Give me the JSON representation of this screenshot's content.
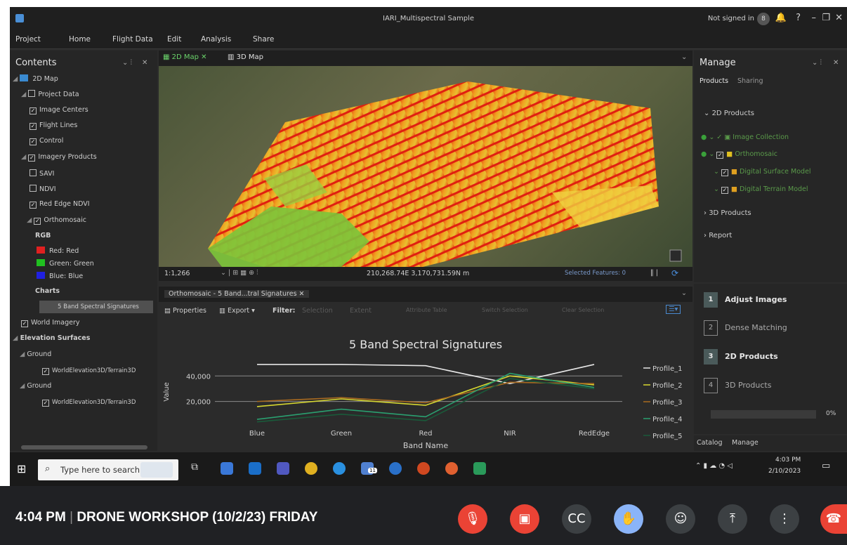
{
  "window": {
    "title": "IARI_Multispectral Sample",
    "signin": "Not signed in",
    "user_initial": "8"
  },
  "ribbon": [
    "Project",
    "Home",
    "Flight Data",
    "Edit",
    "Analysis",
    "Share"
  ],
  "contents": {
    "title": "Contents",
    "rows": [
      "2D Map",
      "Project Data",
      "Image Centers",
      "Flight Lines",
      "Control",
      "Imagery Products",
      "SAVI",
      "NDVI",
      "Red Edge NDVI",
      "Orthomosaic",
      "RGB",
      "Red: Red",
      "Green: Green",
      "Blue: Blue",
      "Charts",
      "5 Band Spectral Signatures",
      "World Imagery",
      "Elevation Surfaces",
      "Ground",
      "WorldElevation3D/Terrain3D",
      "Ground",
      "WorldElevation3D/Terrain3D"
    ]
  },
  "map": {
    "tab_2d": "2D Map",
    "tab_3d": "3D Map",
    "scale": "1:1,266",
    "coords": "210,268.74E 3,170,731.59N m",
    "selected": "Selected Features: 0"
  },
  "chart_pane": {
    "tab": "Orthomosaic - 5 Band...tral Signatures",
    "properties": "Properties",
    "export": "Export",
    "filter": "Filter:",
    "selection": "Selection",
    "extent": "Extent",
    "attribute_table": "Attribute Table",
    "switch_selection": "Switch Selection",
    "clear_selection": "Clear Selection"
  },
  "chart_data": {
    "type": "line",
    "title": "5 Band Spectral Signatures",
    "xlabel": "Band Name",
    "ylabel": "Value",
    "categories": [
      "Blue",
      "Green",
      "Red",
      "NIR",
      "RedEdge"
    ],
    "yticks": [
      "20,000",
      "40,000"
    ],
    "ylim": [
      0,
      55000
    ],
    "grid": true,
    "legend": "right",
    "series": [
      {
        "name": "Profile_1",
        "color": "#e6e6e6",
        "values": [
          49000,
          49000,
          48000,
          34000,
          49000
        ]
      },
      {
        "name": "Profile_2",
        "color": "#d8d830",
        "values": [
          16000,
          22000,
          17000,
          40000,
          33000
        ]
      },
      {
        "name": "Profile_3",
        "color": "#a86a20",
        "values": [
          20000,
          23000,
          19000,
          35000,
          34000
        ]
      },
      {
        "name": "Profile_4",
        "color": "#2aa070",
        "values": [
          6000,
          14000,
          8000,
          42000,
          31000
        ]
      },
      {
        "name": "Profile_5",
        "color": "#1a5a3a",
        "values": [
          4000,
          10000,
          5000,
          38000,
          30000
        ]
      }
    ]
  },
  "manage": {
    "title": "Manage",
    "tab_products": "Products",
    "tab_sharing": "Sharing",
    "d2_products": "2D Products",
    "image_collection": "Image Collection",
    "orthomosaic": "Orthomosaic",
    "dsm": "Digital Surface Model",
    "dtm": "Digital Terrain Model",
    "d3_products": "3D Products",
    "report": "Report"
  },
  "workflow": {
    "steps": [
      {
        "num": "1",
        "label": "Adjust Images"
      },
      {
        "num": "2",
        "label": "Dense Matching"
      },
      {
        "num": "3",
        "label": "2D Products"
      },
      {
        "num": "4",
        "label": "3D Products"
      }
    ],
    "progress": "0%",
    "progress_value": 0
  },
  "bottom_tabs": {
    "catalog": "Catalog",
    "manage": "Manage"
  },
  "taskbar": {
    "search_placeholder": "Type here to search",
    "time": "4:03 PM",
    "date": "2/10/2023",
    "teams_badge": "11"
  },
  "meeting": {
    "label_time": "4:04 PM",
    "label_title": "DRONE WORKSHOP (10/2/23) FRIDAY"
  }
}
